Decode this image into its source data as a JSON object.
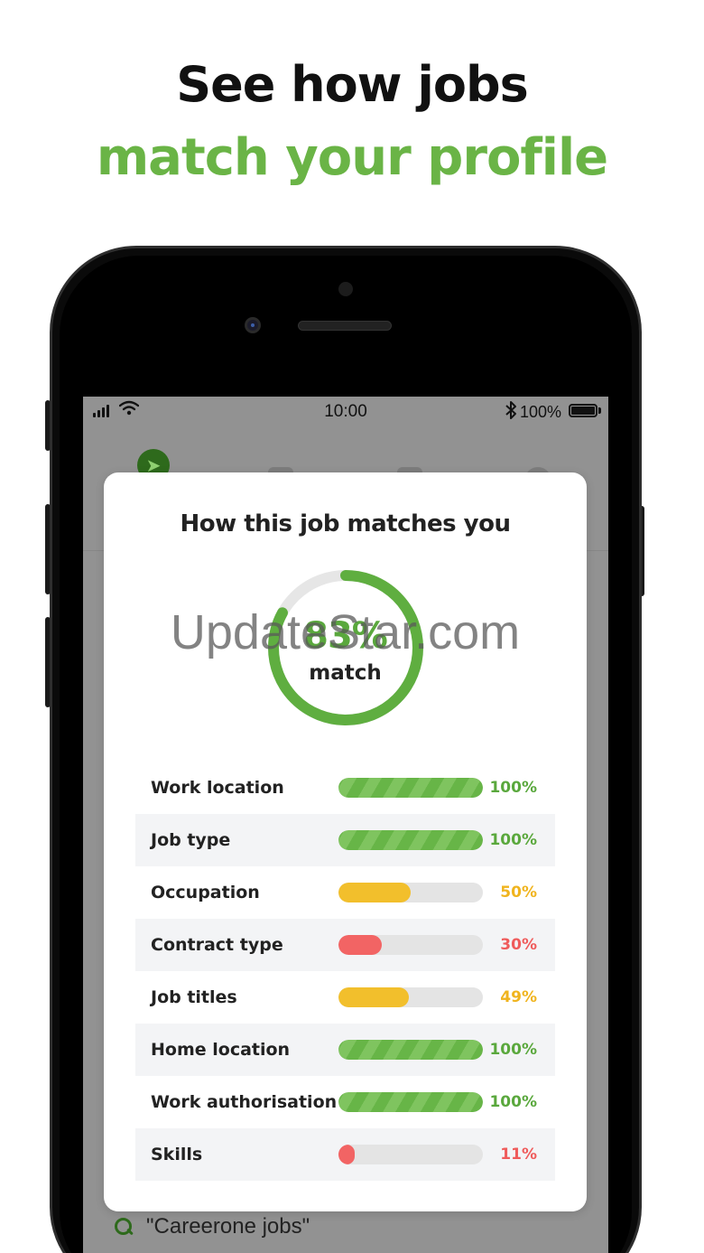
{
  "headline": {
    "line1": "See how jobs",
    "line2": "match your profile"
  },
  "statusbar": {
    "time": "10:00",
    "battery": "100%"
  },
  "card": {
    "title": "How this job matches you",
    "match_percent": 83,
    "match_percent_label": "83%",
    "match_label": "match"
  },
  "watermark": "UpdateStar.com",
  "criteria": [
    {
      "label": "Work location",
      "percent": 100,
      "percent_label": "100%",
      "level": "green"
    },
    {
      "label": "Job type",
      "percent": 100,
      "percent_label": "100%",
      "level": "green"
    },
    {
      "label": "Occupation",
      "percent": 50,
      "percent_label": "50%",
      "level": "yellow"
    },
    {
      "label": "Contract type",
      "percent": 30,
      "percent_label": "30%",
      "level": "red"
    },
    {
      "label": "Job titles",
      "percent": 49,
      "percent_label": "49%",
      "level": "yellow"
    },
    {
      "label": "Home location",
      "percent": 100,
      "percent_label": "100%",
      "level": "green"
    },
    {
      "label": "Work authorisation",
      "percent": 100,
      "percent_label": "100%",
      "level": "green"
    },
    {
      "label": "Skills",
      "percent": 11,
      "percent_label": "11%",
      "level": "red"
    }
  ],
  "search": {
    "text": "\"Careerone jobs\""
  },
  "colors": {
    "brand_green": "#6ab446",
    "yellow": "#f2bf2c",
    "red": "#f26464",
    "track": "#e4e4e4"
  },
  "icons": {
    "compass": "compass-icon",
    "search": "search-icon",
    "wifi": "wifi-icon",
    "bluetooth": "bluetooth-icon",
    "battery": "battery-icon",
    "signal": "signal-icon"
  }
}
